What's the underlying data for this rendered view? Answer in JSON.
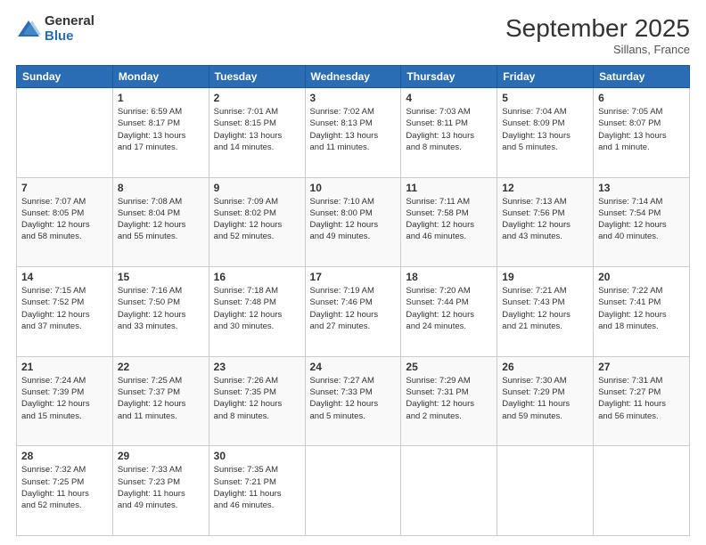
{
  "logo": {
    "general": "General",
    "blue": "Blue"
  },
  "title": "September 2025",
  "location": "Sillans, France",
  "weekdays": [
    "Sunday",
    "Monday",
    "Tuesday",
    "Wednesday",
    "Thursday",
    "Friday",
    "Saturday"
  ],
  "weeks": [
    [
      {
        "day": "",
        "info": ""
      },
      {
        "day": "1",
        "info": "Sunrise: 6:59 AM\nSunset: 8:17 PM\nDaylight: 13 hours\nand 17 minutes."
      },
      {
        "day": "2",
        "info": "Sunrise: 7:01 AM\nSunset: 8:15 PM\nDaylight: 13 hours\nand 14 minutes."
      },
      {
        "day": "3",
        "info": "Sunrise: 7:02 AM\nSunset: 8:13 PM\nDaylight: 13 hours\nand 11 minutes."
      },
      {
        "day": "4",
        "info": "Sunrise: 7:03 AM\nSunset: 8:11 PM\nDaylight: 13 hours\nand 8 minutes."
      },
      {
        "day": "5",
        "info": "Sunrise: 7:04 AM\nSunset: 8:09 PM\nDaylight: 13 hours\nand 5 minutes."
      },
      {
        "day": "6",
        "info": "Sunrise: 7:05 AM\nSunset: 8:07 PM\nDaylight: 13 hours\nand 1 minute."
      }
    ],
    [
      {
        "day": "7",
        "info": "Sunrise: 7:07 AM\nSunset: 8:05 PM\nDaylight: 12 hours\nand 58 minutes."
      },
      {
        "day": "8",
        "info": "Sunrise: 7:08 AM\nSunset: 8:04 PM\nDaylight: 12 hours\nand 55 minutes."
      },
      {
        "day": "9",
        "info": "Sunrise: 7:09 AM\nSunset: 8:02 PM\nDaylight: 12 hours\nand 52 minutes."
      },
      {
        "day": "10",
        "info": "Sunrise: 7:10 AM\nSunset: 8:00 PM\nDaylight: 12 hours\nand 49 minutes."
      },
      {
        "day": "11",
        "info": "Sunrise: 7:11 AM\nSunset: 7:58 PM\nDaylight: 12 hours\nand 46 minutes."
      },
      {
        "day": "12",
        "info": "Sunrise: 7:13 AM\nSunset: 7:56 PM\nDaylight: 12 hours\nand 43 minutes."
      },
      {
        "day": "13",
        "info": "Sunrise: 7:14 AM\nSunset: 7:54 PM\nDaylight: 12 hours\nand 40 minutes."
      }
    ],
    [
      {
        "day": "14",
        "info": "Sunrise: 7:15 AM\nSunset: 7:52 PM\nDaylight: 12 hours\nand 37 minutes."
      },
      {
        "day": "15",
        "info": "Sunrise: 7:16 AM\nSunset: 7:50 PM\nDaylight: 12 hours\nand 33 minutes."
      },
      {
        "day": "16",
        "info": "Sunrise: 7:18 AM\nSunset: 7:48 PM\nDaylight: 12 hours\nand 30 minutes."
      },
      {
        "day": "17",
        "info": "Sunrise: 7:19 AM\nSunset: 7:46 PM\nDaylight: 12 hours\nand 27 minutes."
      },
      {
        "day": "18",
        "info": "Sunrise: 7:20 AM\nSunset: 7:44 PM\nDaylight: 12 hours\nand 24 minutes."
      },
      {
        "day": "19",
        "info": "Sunrise: 7:21 AM\nSunset: 7:43 PM\nDaylight: 12 hours\nand 21 minutes."
      },
      {
        "day": "20",
        "info": "Sunrise: 7:22 AM\nSunset: 7:41 PM\nDaylight: 12 hours\nand 18 minutes."
      }
    ],
    [
      {
        "day": "21",
        "info": "Sunrise: 7:24 AM\nSunset: 7:39 PM\nDaylight: 12 hours\nand 15 minutes."
      },
      {
        "day": "22",
        "info": "Sunrise: 7:25 AM\nSunset: 7:37 PM\nDaylight: 12 hours\nand 11 minutes."
      },
      {
        "day": "23",
        "info": "Sunrise: 7:26 AM\nSunset: 7:35 PM\nDaylight: 12 hours\nand 8 minutes."
      },
      {
        "day": "24",
        "info": "Sunrise: 7:27 AM\nSunset: 7:33 PM\nDaylight: 12 hours\nand 5 minutes."
      },
      {
        "day": "25",
        "info": "Sunrise: 7:29 AM\nSunset: 7:31 PM\nDaylight: 12 hours\nand 2 minutes."
      },
      {
        "day": "26",
        "info": "Sunrise: 7:30 AM\nSunset: 7:29 PM\nDaylight: 11 hours\nand 59 minutes."
      },
      {
        "day": "27",
        "info": "Sunrise: 7:31 AM\nSunset: 7:27 PM\nDaylight: 11 hours\nand 56 minutes."
      }
    ],
    [
      {
        "day": "28",
        "info": "Sunrise: 7:32 AM\nSunset: 7:25 PM\nDaylight: 11 hours\nand 52 minutes."
      },
      {
        "day": "29",
        "info": "Sunrise: 7:33 AM\nSunset: 7:23 PM\nDaylight: 11 hours\nand 49 minutes."
      },
      {
        "day": "30",
        "info": "Sunrise: 7:35 AM\nSunset: 7:21 PM\nDaylight: 11 hours\nand 46 minutes."
      },
      {
        "day": "",
        "info": ""
      },
      {
        "day": "",
        "info": ""
      },
      {
        "day": "",
        "info": ""
      },
      {
        "day": "",
        "info": ""
      }
    ]
  ]
}
